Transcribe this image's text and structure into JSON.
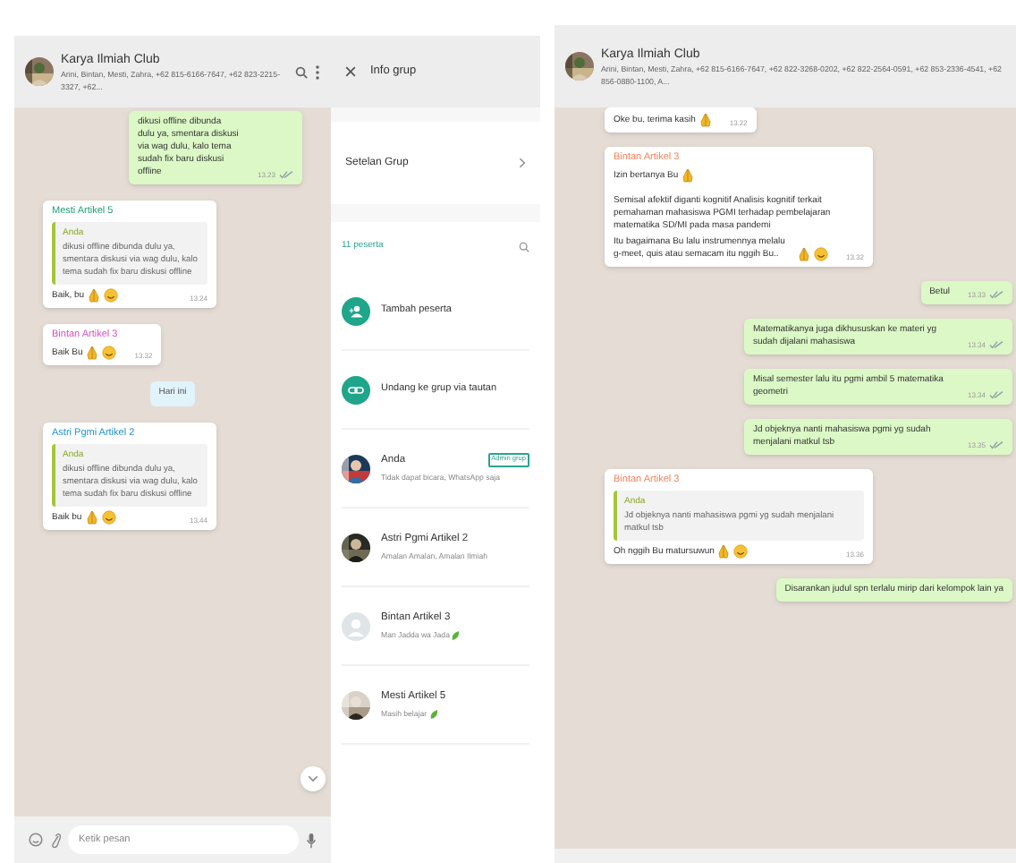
{
  "left_chat": {
    "header": {
      "title": "Karya Ilmiah Club",
      "subtitle": "Arini, Bintan, Mesti, Zahra, +62 815-6166-7647, +62 823-2215-3327, +62..."
    },
    "messages": [
      {
        "kind": "out",
        "paragraphs": [
          "dikusi offline dibunda dulu ya, smentara diskusi via wag dulu, kalo tema sudah fix baru diskusi offline"
        ],
        "time": "13.23"
      },
      {
        "kind": "in",
        "sender": "Mesti Artikel 5",
        "color": "#1f9e74",
        "quote": {
          "author": "Anda",
          "text": "dikusi offline dibunda dulu ya, smentara diskusi via wag dulu, kalo tema sudah fix baru diskusi offline"
        },
        "paragraphs": [
          "Baik, bu"
        ],
        "emoji": [
          {
            "kind": "pray"
          },
          {
            "kind": "smile"
          }
        ],
        "time": "13.24"
      },
      {
        "kind": "in",
        "sender": "Bintan Artikel 3",
        "color": "#d94fc0",
        "paragraphs": [
          "Baik Bu"
        ],
        "emoji": [
          {
            "kind": "pray"
          },
          {
            "kind": "smile"
          }
        ],
        "time": "13.32"
      },
      {
        "kind": "day",
        "text": "Hari ini"
      },
      {
        "kind": "in",
        "sender": "Astri Pgmi Artikel 2",
        "color": "#1e90d0",
        "quote": {
          "author": "Anda",
          "text": "dikusi offline dibunda dulu ya, smentara diskusi via wag dulu, kalo tema sudah fix baru diskusi offline"
        },
        "paragraphs": [
          "Baik bu"
        ],
        "emoji": [
          {
            "kind": "pray"
          },
          {
            "kind": "smile"
          }
        ],
        "time": "13.44"
      }
    ],
    "composer": {
      "placeholder": "Ketik pesan"
    }
  },
  "group_info": {
    "title": "Info grup",
    "settings": "Setelan Grup",
    "participants_count": "11 peserta",
    "actions": [
      {
        "label": "Tambah peserta",
        "kind": "add"
      },
      {
        "label": "Undang ke grup via tautan",
        "kind": "link"
      }
    ],
    "members": [
      {
        "name": "Anda",
        "status": "Tidak dapat bicara, WhatsApp saja",
        "badge": "Admin grup"
      },
      {
        "name": "Astri Pgmi Artikel 2",
        "status": "Amalan Amalan, Amalan Ilmiah"
      },
      {
        "name": "Bintan Artikel 3",
        "status": "Man Jadda wa Jada",
        "leaf": true,
        "avatar": {
          "kind": "default"
        }
      },
      {
        "name": "Mesti Artikel 5",
        "status": "Masih belajar",
        "leaf": true
      }
    ]
  },
  "right_chat": {
    "header": {
      "title": "Karya Ilmiah Club",
      "subtitle": "Arini, Bintan, Mesti, Zahra, +62 815-6166-7647, +62 822-3268-0202, +62 822-2564-0591, +62 853-2336-4541, +62 856-0880-1100, A..."
    },
    "messages": [
      {
        "kind": "in",
        "paragraphs": [
          "Oke bu, terima kasih"
        ],
        "emoji": [
          {
            "kind": "pray"
          }
        ],
        "time": "13.22"
      },
      {
        "kind": "in",
        "sender": "Bintan Artikel 3",
        "color": "#f0845c",
        "paragraphs": [
          "Izin bertanya Bu",
          "Semisal afektif diganti kognitif Analisis kognitif terkait pemahaman mahasiswa PGMI terhadap pembelajaran matematika SD/MI pada masa pandemi",
          "Itu bagaimana Bu lalu instrumennya melalu g-meet, quis atau semacam itu nggih Bu.."
        ],
        "emoji": [
          {
            "kind": "pray"
          },
          {
            "kind": "smile"
          }
        ],
        "inline_emoji": [
          {
            "kind": "pray"
          }
        ],
        "time": "13.32"
      },
      {
        "kind": "out",
        "paragraphs": [
          "Betul"
        ],
        "time": "13.33"
      },
      {
        "kind": "out",
        "paragraphs": [
          "Matematikanya juga dikhususkan ke materi yg sudah dijalani mahasiswa"
        ],
        "time": "13.34"
      },
      {
        "kind": "out",
        "paragraphs": [
          "Misal semester lalu itu pgmi ambil 5 matematika geometri"
        ],
        "time": "13.34"
      },
      {
        "kind": "out",
        "paragraphs": [
          "Jd objeknya nanti mahasiswa pgmi yg sudah menjalani matkul tsb"
        ],
        "time": "13.35"
      },
      {
        "kind": "in",
        "sender": "Bintan Artikel 3",
        "color": "#f0845c",
        "quote": {
          "author": "Anda",
          "text": "Jd objeknya nanti mahasiswa pgmi yg sudah menjalani matkul tsb"
        },
        "paragraphs": [
          "Oh nggih Bu matursuwun"
        ],
        "emoji": [
          {
            "kind": "pray"
          },
          {
            "kind": "smile"
          }
        ],
        "time": "13.36"
      },
      {
        "kind": "out",
        "paragraphs": [
          "Disarankan judul spn terlalu mirip dari kelompok lain ya"
        ]
      }
    ]
  }
}
